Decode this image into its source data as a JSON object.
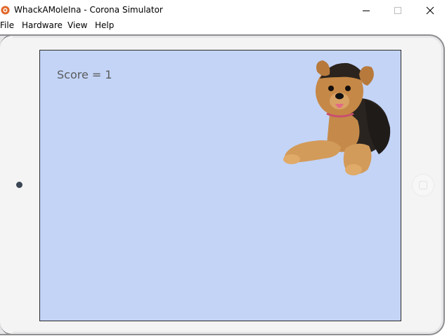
{
  "window": {
    "title": "WhackAMoleIna - Corona Simulator",
    "buttons": {
      "minimize_icon": "minimize-icon",
      "maximize_icon": "maximize-icon",
      "close_icon": "close-icon"
    }
  },
  "menu": {
    "items": [
      "File",
      "Hardware",
      "View",
      "Help"
    ]
  },
  "game": {
    "score_text": "Score = 1",
    "target": "dog-sprite"
  },
  "colors": {
    "screen_background": "#c3d4f7",
    "score_text": "#5b5b5b",
    "device_frame": "#f4f4f5",
    "app_icon": "#e2672a"
  }
}
